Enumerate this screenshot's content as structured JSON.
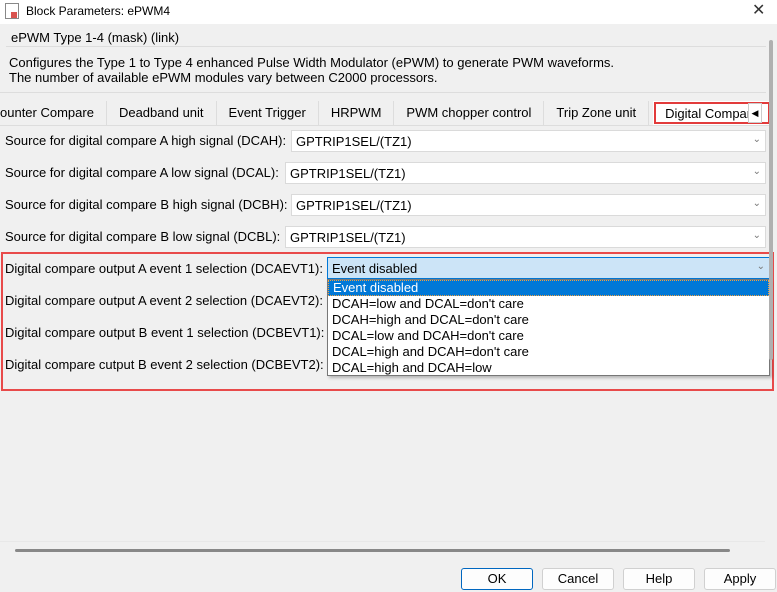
{
  "window": {
    "title": "Block Parameters: ePWM4",
    "close": "✕"
  },
  "group": {
    "title": "ePWM Type 1-4 (mask) (link)",
    "desc1": "Configures the Type 1 to Type 4 enhanced Pulse Width Modulator (ePWM) to generate PWM waveforms.",
    "desc2": "The number of available ePWM modules vary between C2000 processors."
  },
  "tabs": [
    "ounter Compare",
    "Deadband unit",
    "Event Trigger",
    "HRPWM",
    "PWM chopper control",
    "Trip Zone unit",
    "Digital Compare"
  ],
  "tab_arrow": "◀",
  "params": [
    {
      "label": "Source for digital compare A high signal (DCAH):",
      "value": "GPTRIP1SEL/(TZ1)"
    },
    {
      "label": "Source for digital compare A low signal (DCAL):",
      "value": "GPTRIP1SEL/(TZ1)"
    },
    {
      "label": "Source for digital compare B high signal (DCBH):",
      "value": "GPTRIP1SEL/(TZ1)"
    },
    {
      "label": "Source for digital compare B low signal (DCBL):",
      "value": "GPTRIP1SEL/(TZ1)"
    },
    {
      "label": "Digital compare output A event 1 selection (DCAEVT1):",
      "value": "Event disabled"
    },
    {
      "label": "Digital compare output A event 2 selection (DCAEVT2):"
    },
    {
      "label": "Digital compare output B event 1 selection (DCBEVT1):"
    },
    {
      "label": "Digital compare cutput B event 2 selection (DCBEVT2):"
    }
  ],
  "dropdown_options": [
    "Event disabled",
    "DCAH=low and DCAL=don't care",
    "DCAH=high and DCAL=don't care",
    "DCAL=low and DCAH=don't care",
    "DCAL=high and DCAH=don't care",
    "DCAL=high and DCAH=low"
  ],
  "chevron": "⌄",
  "buttons": {
    "ok": "OK",
    "cancel": "Cancel",
    "help": "Help",
    "apply": "Apply"
  }
}
